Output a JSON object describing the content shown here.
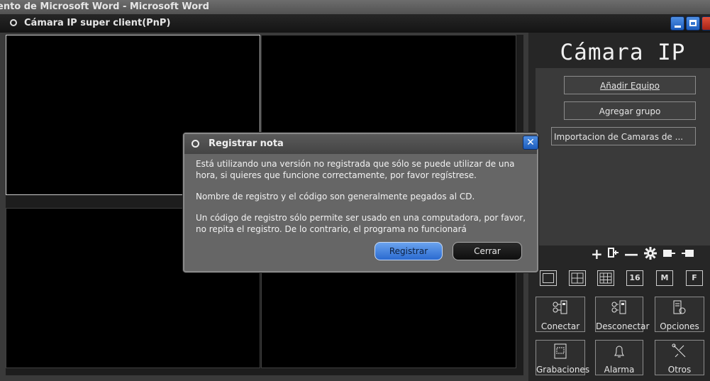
{
  "background_window": {
    "title": "ento de Microsoft Word - Microsoft Word"
  },
  "app": {
    "title": "Cámara IP super client(PnP)",
    "window_controls": [
      "minimize",
      "maximize",
      "close"
    ]
  },
  "side_panel": {
    "title": "Cámara IP",
    "buttons": [
      {
        "label": "Añadir Equipo"
      },
      {
        "label": "Agregar grupo"
      },
      {
        "label": "Importacion de Camaras de ..."
      }
    ],
    "toolbar_icons": [
      "add-icon",
      "device-icon",
      "remove-icon",
      "settings-icon",
      "export-icon",
      "import-icon"
    ],
    "layouts": [
      "1",
      "4",
      "9",
      "16",
      "M",
      "F"
    ],
    "tiles": [
      {
        "label": "Conectar",
        "icon": "connect-icon"
      },
      {
        "label": "Desconectar",
        "icon": "disconnect-icon"
      },
      {
        "label": "Opciones",
        "icon": "options-icon"
      },
      {
        "label": "Grabaciones",
        "icon": "recordings-icon"
      },
      {
        "label": "Alarma",
        "icon": "bell-icon"
      },
      {
        "label": "Otros",
        "icon": "tools-icon"
      }
    ]
  },
  "dialog": {
    "title": "Registrar nota",
    "paragraphs": [
      "Está utilizando una versión no registrada que sólo se puede utilizar de una hora, si quieres que funcione correctamente, por favor regístrese.",
      "Nombre de registro y el código son generalmente pegados al CD.",
      "Un código de registro sólo permite ser usado en una computadora, por favor, no repita el registro. De lo contrario, el programa no funcionará"
    ],
    "primary_button": "Registrar",
    "secondary_button": "Cerrar"
  },
  "colors": {
    "dialog_primary": "#2a6ad0",
    "window_control": "#1d5dbd",
    "panel_bg": "#262626",
    "video_bg": "#000000"
  }
}
